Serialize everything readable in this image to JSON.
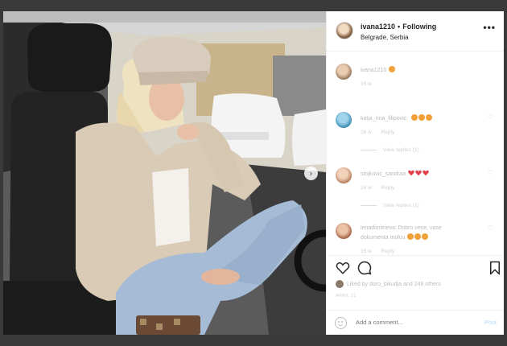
{
  "post": {
    "username": "ivana1210",
    "separator": "•",
    "follow_status": "Following",
    "location": "Belgrade, Serbia",
    "more_icon": "more-horizontal-icon"
  },
  "comments": [
    {
      "user": "ivana1210",
      "text": "",
      "emoji": "smiling-face-with-hearts",
      "age": "16 w",
      "reply": "",
      "view_replies": "",
      "avatar_color": "#a0826a"
    },
    {
      "user": "katja_rina_filipovic",
      "text": "",
      "emoji": "clapping-hands x3",
      "age": "16 w",
      "reply": "Reply",
      "view_replies": "View replies (1)",
      "avatar_color": "#59a6c9"
    },
    {
      "user": "stojkovic_sandraa",
      "text": "",
      "emoji": "red-heart x3",
      "age": "16 w",
      "reply": "Reply",
      "view_replies": "View replies (1)",
      "avatar_color": "#d9a88a"
    },
    {
      "user": "lenadimitrievic",
      "text": "Dobro vece, vase",
      "text2": "dokumenta molcu",
      "emoji": "grinning-squinting-face x3",
      "age": "16 w",
      "reply": "Reply",
      "view_replies": "",
      "avatar_color": "#c68b6f"
    }
  ],
  "actions": {
    "like_icon": "heart-icon",
    "comment_icon": "comment-icon",
    "save_icon": "bookmark-icon"
  },
  "likes_text": "Liked by doro_bikudja and 249 others",
  "date": "APRIL 21",
  "add_comment": {
    "placeholder": "Add a comment...",
    "post_label": "Post",
    "emoji_icon": "smile-icon"
  },
  "photo": {
    "next_icon": "chevron-right-icon"
  }
}
